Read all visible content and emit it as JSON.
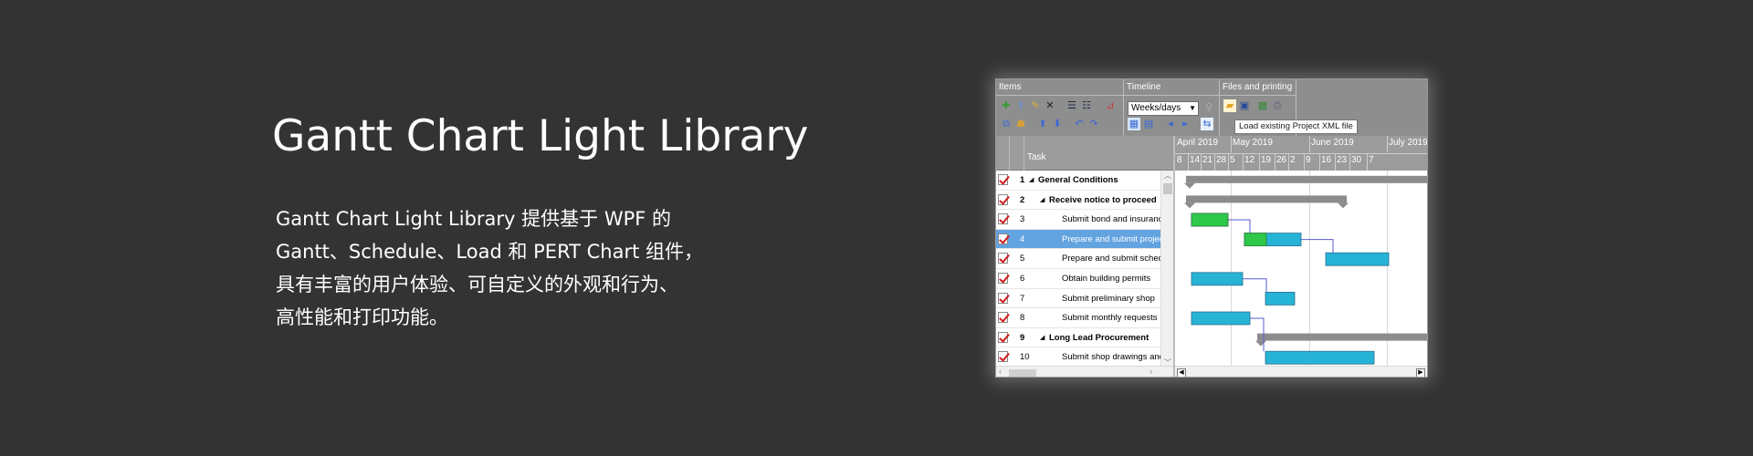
{
  "hero": {
    "title": "Gantt Chart Light Library",
    "description_lines": [
      "Gantt Chart Light Library 提供基于 WPF 的",
      "Gantt、Schedule、Load 和 PERT Chart 组件，",
      "具有丰富的用户体验、可自定义的外观和行为、",
      "高性能和打印功能。"
    ]
  },
  "ribbon": {
    "groups": [
      "Items",
      "Timeline",
      "Files and printing"
    ],
    "timeline_scale": "Weeks/days",
    "tooltip": "Load existing Project XML file"
  },
  "grid": {
    "task_header": "Task",
    "rows": [
      {
        "num": "1",
        "name": "General Conditions",
        "bold": true,
        "summary": true
      },
      {
        "num": "2",
        "name": "Receive notice to proceed",
        "bold": true,
        "summary": true
      },
      {
        "num": "3",
        "name": "Submit bond and insurance"
      },
      {
        "num": "4",
        "name": "Prepare and submit project",
        "selected": true
      },
      {
        "num": "5",
        "name": "Prepare and submit schedule"
      },
      {
        "num": "6",
        "name": "Obtain building permits"
      },
      {
        "num": "7",
        "name": "Submit preliminary shop"
      },
      {
        "num": "8",
        "name": "Submit monthly requests"
      },
      {
        "num": "9",
        "name": "Long Lead Procurement",
        "bold": true,
        "summary": true
      },
      {
        "num": "10",
        "name": "Submit shop drawings and"
      }
    ]
  },
  "chart": {
    "months": [
      "April 2019",
      "May 2019",
      "June 2019",
      "July 2019"
    ],
    "days": [
      "8",
      "14",
      "21",
      "28",
      "5",
      "12",
      "19",
      "26",
      "2",
      "9",
      "16",
      "23",
      "30",
      "7"
    ],
    "colors": {
      "bar": "#27b3d6",
      "completed": "#2ec84a",
      "summary": "#8c8c8c",
      "link": "#5a5ad6"
    }
  }
}
